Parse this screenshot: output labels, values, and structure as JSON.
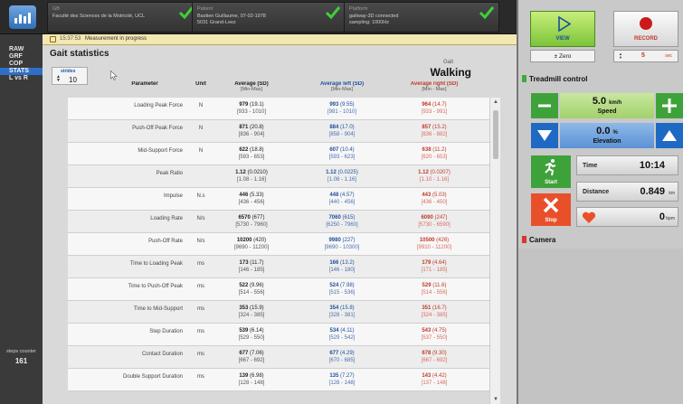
{
  "topbar": {
    "site": {
      "line1": "GB",
      "line2": "Faculté des Sciences de la Motricité, UCL"
    },
    "subject": {
      "line1": "Patient",
      "line2": "Bastien Guillaume, 07-02-1978",
      "line3": "5031 Grand-Leez"
    },
    "device": {
      "line1": "Platform",
      "line2": "gaitway-3D connected",
      "line3": "sampling: 1000Hz"
    }
  },
  "nav": {
    "items": [
      {
        "label": "RAW",
        "active": false
      },
      {
        "label": "GRF",
        "active": false
      },
      {
        "label": "COP",
        "active": false
      },
      {
        "label": "STATS",
        "active": true
      },
      {
        "label": "L vs R",
        "active": false
      }
    ],
    "steps_counter": {
      "label": "steps counter",
      "value": "161"
    }
  },
  "message": {
    "time": "15:37:53",
    "text": "Measurement in progress"
  },
  "page": {
    "title": "Gait statistics",
    "strides_label": "strides",
    "strides_value": "10",
    "gait_small": "Gait",
    "gait_mode": "Walking"
  },
  "table": {
    "headers": {
      "parameter": "Parameter",
      "unit": "Unit",
      "average": "Average (SD)",
      "average_sub": "[Min-Max]",
      "left": "Average left (SD)",
      "left_sub": "[Min-Max]",
      "right": "Average right (SD)",
      "right_sub": "[Min - Max]"
    },
    "rows": [
      {
        "param": "Loading Peak Force",
        "unit": "N",
        "avg": "979",
        "avg_sd": "(19.1)",
        "avg_rng": "[933 - 1010]",
        "left": "993",
        "left_sd": "(9.55)",
        "left_rng": "[981 - 1010]",
        "right": "964",
        "right_sd": "(14.7)",
        "right_rng": "[933 - 991]"
      },
      {
        "param": "Push-Off Peak Force",
        "unit": "N",
        "avg": "871",
        "avg_sd": "(20.8)",
        "avg_rng": "[836 - 904]",
        "left": "884",
        "left_sd": "(17.0)",
        "left_rng": "[858 - 904]",
        "right": "857",
        "right_sd": "(15.2)",
        "right_rng": "[836 - 882]"
      },
      {
        "param": "Mid-Support Force",
        "unit": "N",
        "avg": "622",
        "avg_sd": "(18.8)",
        "avg_rng": "[593 - 653]",
        "left": "607",
        "left_sd": "(10.4)",
        "left_rng": "[593 - 623]",
        "right": "638",
        "right_sd": "(11.2)",
        "right_rng": "[620 - 653]"
      },
      {
        "param": "Peak Ratio",
        "unit": "",
        "avg": "1.12",
        "avg_sd": "(0.0210)",
        "avg_rng": "[1.08 - 1.16]",
        "left": "1.12",
        "left_sd": "(0.0225)",
        "left_rng": "[1.08 - 1.16]",
        "right": "1.12",
        "right_sd": "(0.0207)",
        "right_rng": "[1.10 - 1.16]"
      },
      {
        "param": "Impulse",
        "unit": "N.s",
        "avg": "446",
        "avg_sd": "(5.33)",
        "avg_rng": "[436 - 456]",
        "left": "448",
        "left_sd": "(4.57)",
        "left_rng": "[440 - 456]",
        "right": "443",
        "right_sd": "(5.03)",
        "right_rng": "[436 - 450]"
      },
      {
        "param": "Loading Rate",
        "unit": "N/s",
        "avg": "6570",
        "avg_sd": "(677)",
        "avg_rng": "[5730 - 7960]",
        "left": "7060",
        "left_sd": "(615)",
        "left_rng": "[6250 - 7960]",
        "right": "6090",
        "right_sd": "(247)",
        "right_rng": "[5730 - 6590]"
      },
      {
        "param": "Push-Off Rate",
        "unit": "N/s",
        "avg": "10200",
        "avg_sd": "(420)",
        "avg_rng": "[9690 - 11200]",
        "left": "9980",
        "left_sd": "(227)",
        "left_rng": "[9690 - 10300]",
        "right": "10500",
        "right_sd": "(426)",
        "right_rng": "[9910 - 11200]"
      },
      {
        "param": "Time to Loading Peak",
        "unit": "ms",
        "avg": "173",
        "avg_sd": "(11.7)",
        "avg_rng": "[146 - 185]",
        "left": "166",
        "left_sd": "(13.2)",
        "left_rng": "[146 - 180]",
        "right": "179",
        "right_sd": "(4.64)",
        "right_rng": "[171 - 185]"
      },
      {
        "param": "Time to Push-Off Peak",
        "unit": "ms",
        "avg": "522",
        "avg_sd": "(9.96)",
        "avg_rng": "[514 - 556]",
        "left": "524",
        "left_sd": "(7.98)",
        "left_rng": "[515 - 536]",
        "right": "529",
        "right_sd": "(11.6)",
        "right_rng": "[514 - 556]"
      },
      {
        "param": "Time to Mid-Support",
        "unit": "ms",
        "avg": "353",
        "avg_sd": "(15.9)",
        "avg_rng": "[324 - 385]",
        "left": "354",
        "left_sd": "(15.8)",
        "left_rng": "[328 - 381]",
        "right": "351",
        "right_sd": "(16.7)",
        "right_rng": "[324 - 385]"
      },
      {
        "param": "Step Duration",
        "unit": "ms",
        "avg": "539",
        "avg_sd": "(6.14)",
        "avg_rng": "[529 - 550]",
        "left": "534",
        "left_sd": "(4.11)",
        "left_rng": "[529 - 542]",
        "right": "543",
        "right_sd": "(4.75)",
        "right_rng": "[537 - 550]"
      },
      {
        "param": "Contact Duration",
        "unit": "ms",
        "avg": "677",
        "avg_sd": "(7.06)",
        "avg_rng": "[667 - 692]",
        "left": "677",
        "left_sd": "(4.29)",
        "left_rng": "[670 - 685]",
        "right": "678",
        "right_sd": "(9.30)",
        "right_rng": "[667 - 692]"
      },
      {
        "param": "Double Support Duration",
        "unit": "ms",
        "avg": "139",
        "avg_sd": "(6.98)",
        "avg_rng": "[128 - 148]",
        "left": "135",
        "left_sd": "(7.27)",
        "left_rng": "[128 - 148]",
        "right": "143",
        "right_sd": "(4.42)",
        "right_rng": "[137 - 148]"
      }
    ]
  },
  "controls": {
    "view_label": "VIEW",
    "record_label": "RECORD",
    "zero_label": "Zero",
    "record_time_value": "5",
    "record_time_unit": "sec"
  },
  "treadmill": {
    "header": "Treadmill control",
    "speed_value": "5.0",
    "speed_unit": "km/h",
    "speed_label": "Speed",
    "elevation_value": "0.0",
    "elevation_unit": "%",
    "elevation_label": "Elevation",
    "start_label": "Start",
    "stop_label": "Stop",
    "time_label": "Time",
    "time_value": "10:14",
    "distance_label": "Distance",
    "distance_value": "0.849",
    "distance_unit": "km",
    "bpm_value": "0",
    "bpm_unit": "bpm"
  },
  "camera": {
    "header": "Camera"
  },
  "colors": {
    "accent_blue": "#2e6fc7",
    "green": "#3ea23a",
    "red": "#d9372a",
    "left_series": "#1f4f9e",
    "right_series": "#c0392b"
  }
}
